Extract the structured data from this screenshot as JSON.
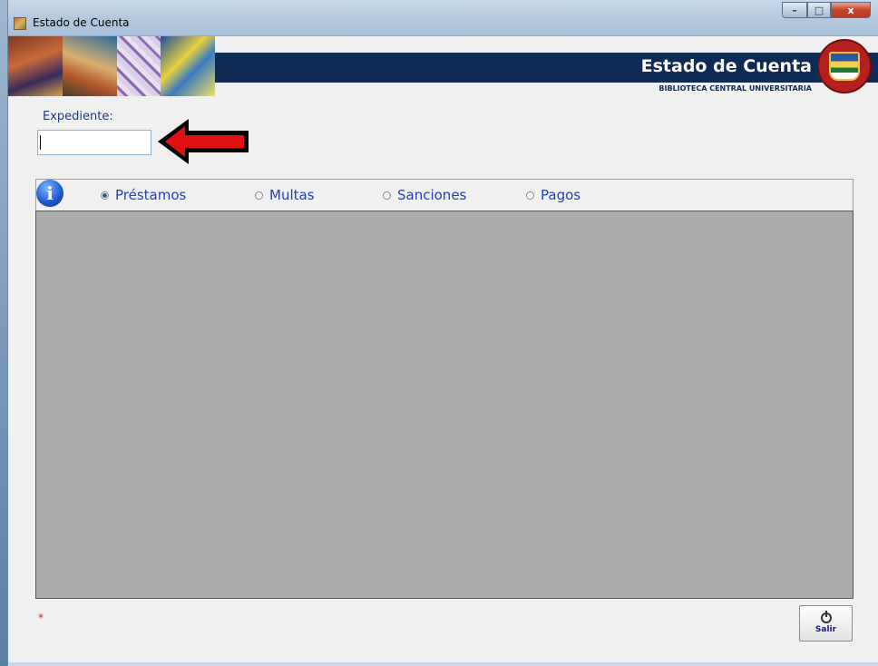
{
  "window": {
    "title": "Estado de Cuenta",
    "controls": {
      "minimize": "–",
      "maximize": "□",
      "close": "x"
    }
  },
  "banner": {
    "title": "Estado de Cuenta",
    "subtitle": "BIBLIOTECA CENTRAL UNIVERSITARIA"
  },
  "form": {
    "expediente_label": "Expediente:",
    "expediente_value": ""
  },
  "tabs": [
    {
      "label": "Préstamos",
      "selected": true
    },
    {
      "label": "Multas",
      "selected": false
    },
    {
      "label": "Sanciones",
      "selected": false
    },
    {
      "label": "Pagos",
      "selected": false
    }
  ],
  "info_icon_glyph": "i",
  "footer": {
    "required_marker": "*",
    "exit_label": "Salir"
  },
  "colors": {
    "banner_navy": "#0f2a55",
    "tab_text": "#1f3fbf",
    "grid_bg": "#ababab",
    "arrow_red": "#e01010"
  }
}
